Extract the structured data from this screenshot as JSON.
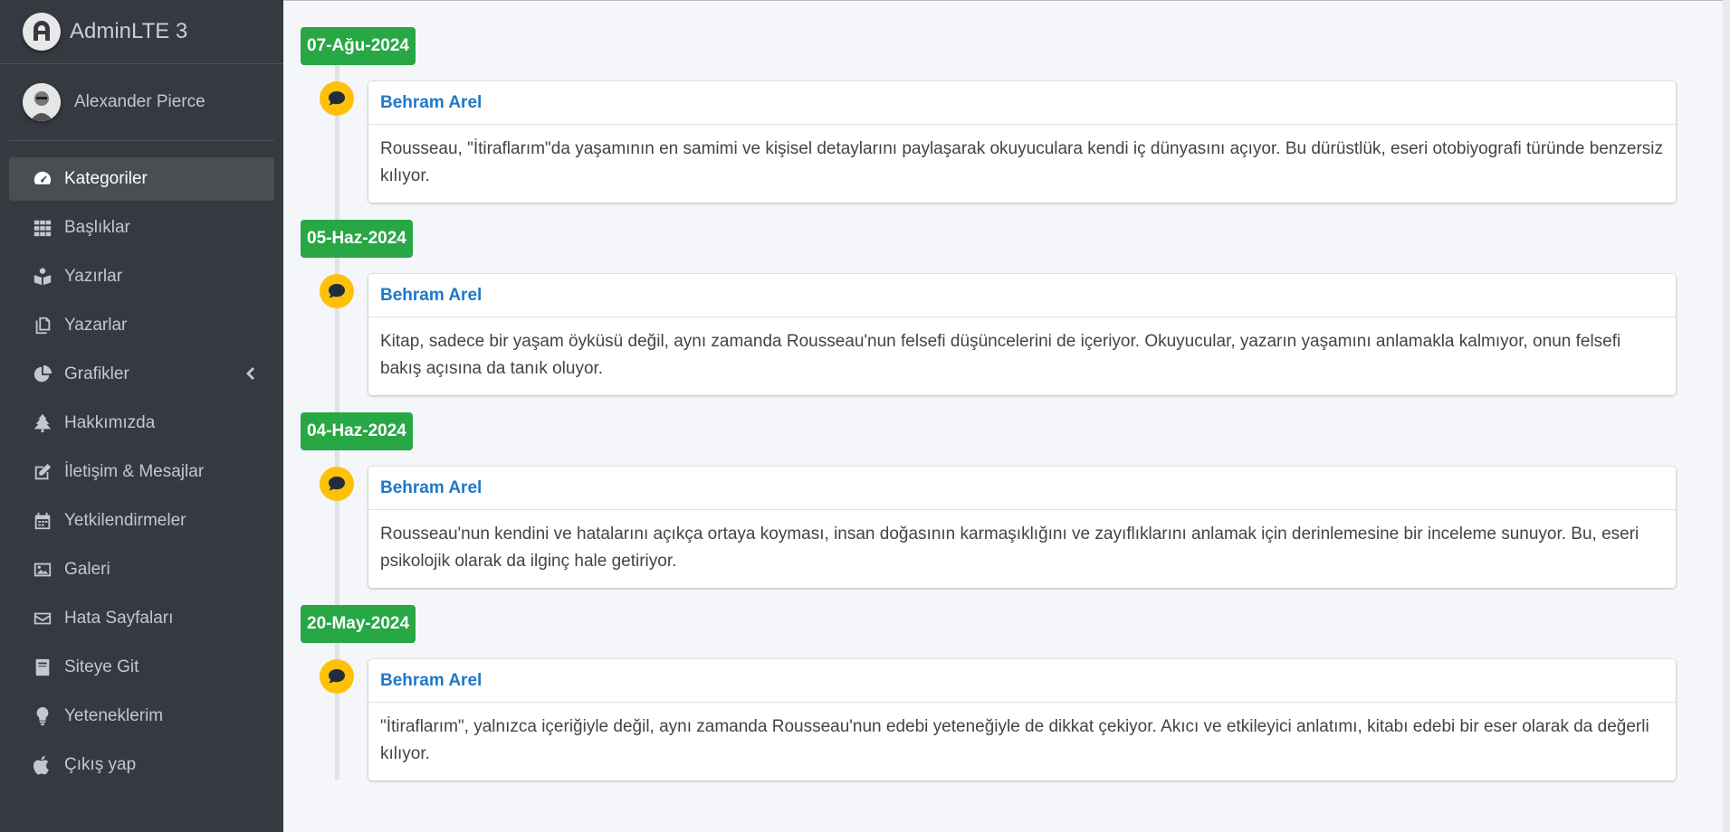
{
  "brand": {
    "title": "AdminLTE 3"
  },
  "user": {
    "name": "Alexander Pierce"
  },
  "sidebar": {
    "items": [
      {
        "label": "Kategoriler",
        "icon": "tachometer-icon"
      },
      {
        "label": "Başlıklar",
        "icon": "grid-icon"
      },
      {
        "label": "Yazırlar",
        "icon": "book-reader-icon"
      },
      {
        "label": "Yazarlar",
        "icon": "copy-icon"
      },
      {
        "label": "Grafikler",
        "icon": "pie-chart-icon"
      },
      {
        "label": "Hakkımızda",
        "icon": "tree-icon"
      },
      {
        "label": "İletişim & Mesajlar",
        "icon": "edit-icon"
      },
      {
        "label": "Yetkilendirmeler",
        "icon": "calendar-icon"
      },
      {
        "label": "Galeri",
        "icon": "image-icon"
      },
      {
        "label": "Hata Sayfaları",
        "icon": "envelope-icon"
      },
      {
        "label": "Siteye Git",
        "icon": "book-icon"
      },
      {
        "label": "Yeteneklerim",
        "icon": "lightbulb-icon"
      },
      {
        "label": "Çıkış yap",
        "icon": "apple-icon"
      }
    ]
  },
  "timeline": [
    {
      "date": "07-Ağu-2024",
      "author": "Behram Arel",
      "text": "Rousseau, \"İtiraflarım\"da yaşamının en samimi ve kişisel detaylarını paylaşarak okuyuculara kendi iç dünyasını açıyor. Bu dürüstlük, eseri otobiyografi türünde benzersiz kılıyor."
    },
    {
      "date": "05-Haz-2024",
      "author": "Behram Arel",
      "text": "Kitap, sadece bir yaşam öyküsü değil, aynı zamanda Rousseau'nun felsefi düşüncelerini de içeriyor. Okuyucular, yazarın yaşamını anlamakla kalmıyor, onun felsefi bakış açısına da tanık oluyor."
    },
    {
      "date": "04-Haz-2024",
      "author": "Behram Arel",
      "text": "Rousseau'nun kendini ve hatalarını açıkça ortaya koyması, insan doğasının karmaşıklığını ve zayıflıklarını anlamak için derinlemesine bir inceleme sunuyor. Bu, eseri psikolojik olarak da ilginç hale getiriyor."
    },
    {
      "date": "20-May-2024",
      "author": "Behram Arel",
      "text": "\"İtiraflarım\", yalnızca içeriğiyle değil, aynı zamanda Rousseau'nun edebi yeteneğiyle de dikkat çekiyor. Akıcı ve etkileyici anlatımı, kitabı edebi bir eser olarak da değerli kılıyor."
    }
  ],
  "colors": {
    "sidebar_bg": "#343a40",
    "label_green": "#28a745",
    "icon_yellow": "#ffc107",
    "author_blue": "#1e78c8"
  }
}
